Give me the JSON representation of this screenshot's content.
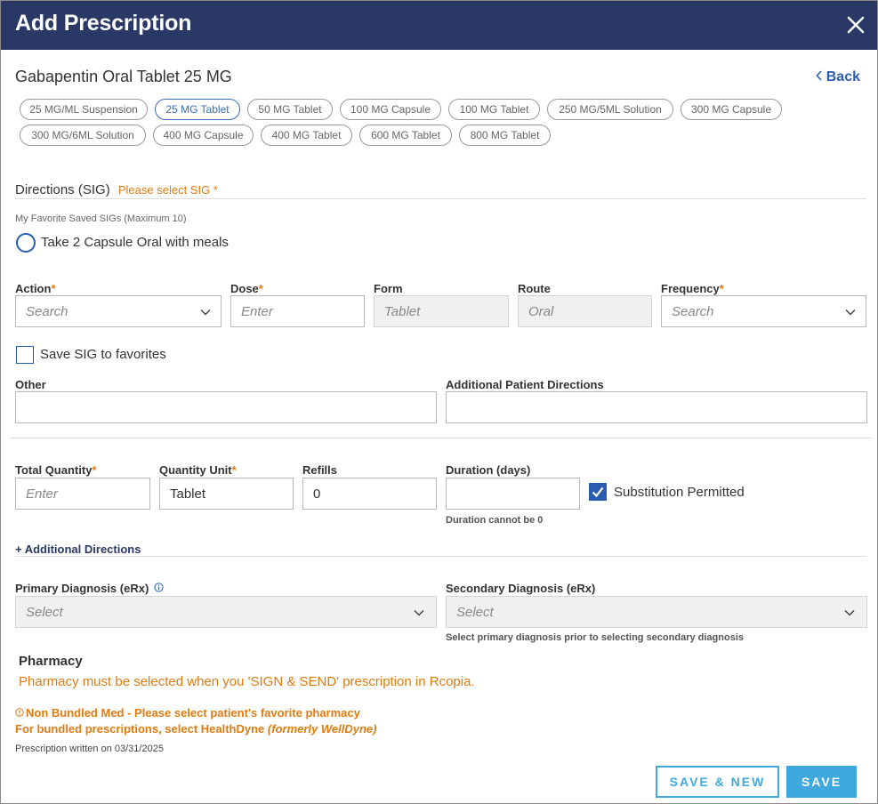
{
  "header": {
    "title": "Add Prescription"
  },
  "drug": {
    "name": "Gabapentin Oral Tablet 25 MG",
    "back_label": "Back"
  },
  "strengths": [
    {
      "label": "25 MG/ML Suspension",
      "selected": false
    },
    {
      "label": "25 MG Tablet",
      "selected": true
    },
    {
      "label": "50 MG Tablet",
      "selected": false
    },
    {
      "label": "100 MG Capsule",
      "selected": false
    },
    {
      "label": "100 MG Tablet",
      "selected": false
    },
    {
      "label": "250 MG/5ML Solution",
      "selected": false
    },
    {
      "label": "300 MG Capsule",
      "selected": false
    },
    {
      "label": "300 MG/6ML Solution",
      "selected": false
    },
    {
      "label": "400 MG Capsule",
      "selected": false
    },
    {
      "label": "400 MG Tablet",
      "selected": false
    },
    {
      "label": "600 MG Tablet",
      "selected": false
    },
    {
      "label": "800 MG Tablet",
      "selected": false
    }
  ],
  "sig": {
    "label": "Directions (SIG)",
    "warning": "Please select SIG *",
    "favorites_label": "My Favorite Saved SIGs (Maximum 10)",
    "favorite_option": "Take 2 Capsule Oral with meals"
  },
  "fields": {
    "action": {
      "label": "Action",
      "placeholder": "Search"
    },
    "dose": {
      "label": "Dose",
      "placeholder": "Enter"
    },
    "form": {
      "label": "Form",
      "value": "Tablet"
    },
    "route": {
      "label": "Route",
      "value": "Oral"
    },
    "frequency": {
      "label": "Frequency",
      "placeholder": "Search"
    },
    "save_sig_label": "Save SIG to favorites",
    "other": {
      "label": "Other"
    },
    "additional_patient_directions": {
      "label": "Additional Patient Directions"
    },
    "total_quantity": {
      "label": "Total Quantity",
      "placeholder": "Enter"
    },
    "quantity_unit": {
      "label": "Quantity Unit",
      "value": "Tablet"
    },
    "refills": {
      "label": "Refills",
      "value": "0"
    },
    "duration": {
      "label": "Duration (days)",
      "note": "Duration cannot be 0"
    },
    "substitution": {
      "label": "Substitution Permitted",
      "checked": true
    },
    "additional_directions_link": "+ Additional Directions",
    "primary_diagnosis": {
      "label": "Primary Diagnosis (eRx)",
      "placeholder": "Select"
    },
    "secondary_diagnosis": {
      "label": "Secondary Diagnosis (eRx)",
      "placeholder": "Select",
      "note": "Select primary diagnosis prior to selecting secondary diagnosis"
    },
    "required_marker": "*"
  },
  "pharmacy": {
    "title": "Pharmacy",
    "warning": "Pharmacy must be selected when you 'SIGN & SEND' prescription in Rcopia.",
    "non_bundled": "Non Bundled Med - Please select patient's favorite pharmacy",
    "bundled_prefix": "For bundled prescriptions, select HealthDyne ",
    "bundled_italic": "(formerly WellDyne)"
  },
  "footer": {
    "written": "Prescription written on 03/31/2025",
    "save_new": "SAVE & NEW",
    "save": "SAVE"
  },
  "colors": {
    "header_bg": "#2a3866",
    "accent_blue": "#2a5db0",
    "warning_orange": "#e07b10",
    "button_blue": "#3fa9dd"
  }
}
